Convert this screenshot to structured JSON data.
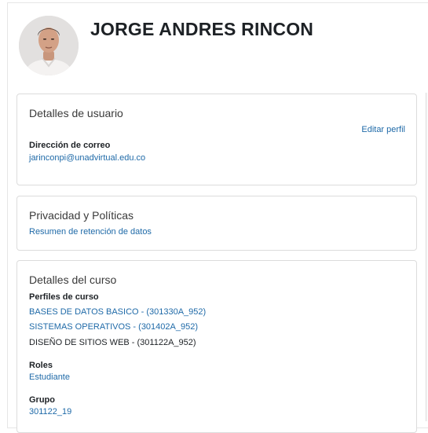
{
  "profile": {
    "name": "JORGE ANDRES RINCON",
    "avatar_icon": "user-photo"
  },
  "user_details": {
    "title": "Detalles de usuario",
    "edit_link": "Editar perfil",
    "email_label": "Dirección de correo",
    "email": "jarinconpi@unadvirtual.edu.co"
  },
  "privacy": {
    "title": "Privacidad y Políticas",
    "retention_link": "Resumen de retención de datos"
  },
  "course_details": {
    "title": "Detalles del curso",
    "profiles_label": "Perfiles de curso",
    "courses": [
      {
        "label": "BASES DE DATOS BASICO - (301330A_952)",
        "is_link": true
      },
      {
        "label": "SISTEMAS OPERATIVOS - (301402A_952)",
        "is_link": true
      },
      {
        "label": "DISEÑO DE SITIOS WEB - (301122A_952)",
        "is_link": false
      }
    ],
    "roles_label": "Roles",
    "role": "Estudiante",
    "group_label": "Grupo",
    "group": "301122_19"
  },
  "colors": {
    "link": "#1f6aa8",
    "border": "#dcdcdc",
    "text": "#1d2125"
  }
}
